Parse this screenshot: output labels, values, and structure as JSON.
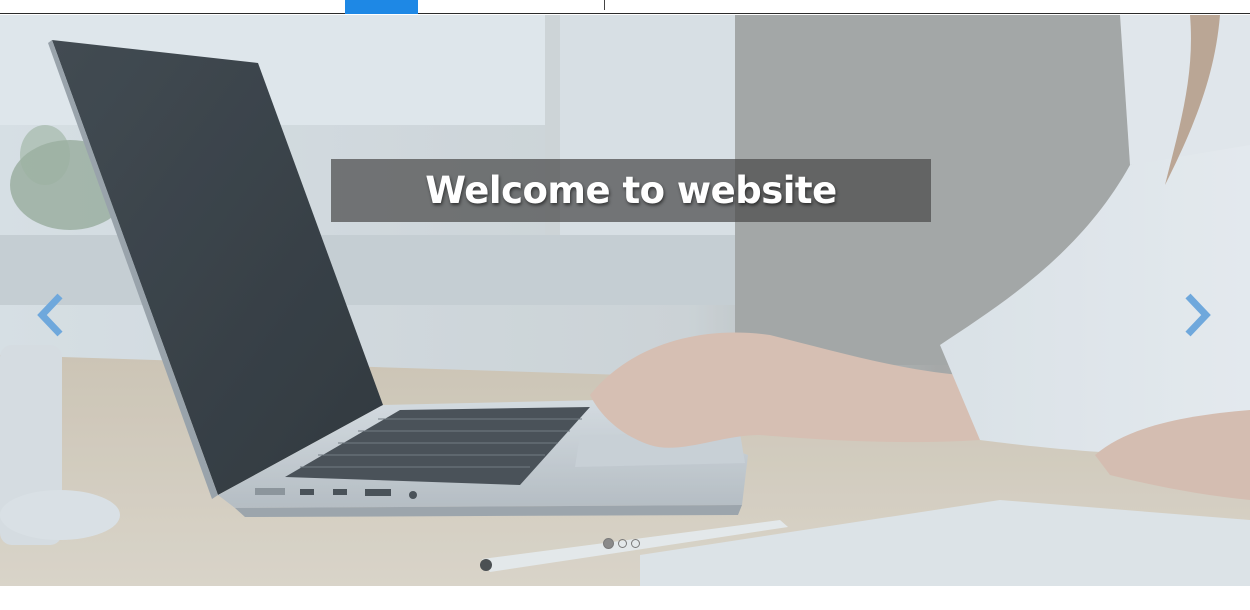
{
  "hero": {
    "caption": "Welcome to website"
  },
  "carousel": {
    "slide_count": 3,
    "active_index": 0
  },
  "icons": {
    "prev": "chevron-left-icon",
    "next": "chevron-right-icon"
  },
  "colors": {
    "nav_active": "#1e88e5",
    "arrow": "#6fa8dc",
    "caption_bg": "#4b4b4b"
  }
}
